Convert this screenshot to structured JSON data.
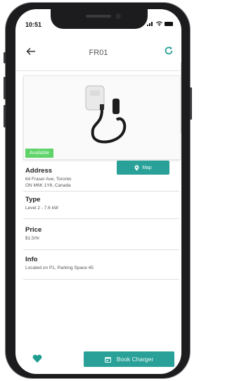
{
  "status_bar": {
    "time": "10:51"
  },
  "header": {
    "title": "FR01"
  },
  "charger": {
    "availability": "Available"
  },
  "address": {
    "label": "Address",
    "line1": "64 Fraser Ave, Toronto",
    "line2": "ON M6K 1Y6, Canada",
    "map_button": "Map"
  },
  "type": {
    "label": "Type",
    "value": "Level 2 - 7.6 kW"
  },
  "price": {
    "label": "Price",
    "value": "$1.5/hr"
  },
  "info": {
    "label": "Info",
    "value": "Located on P1, Parking Space 45"
  },
  "footer": {
    "book_button": "Book Charger"
  },
  "colors": {
    "accent": "#2aa198",
    "available": "#5fd36a",
    "heart": "#1f9d8e"
  },
  "icons": {
    "back": "arrow-left-icon",
    "refresh": "refresh-icon",
    "map": "map-pin-icon",
    "favorite": "heart-icon",
    "book": "calendar-icon"
  }
}
